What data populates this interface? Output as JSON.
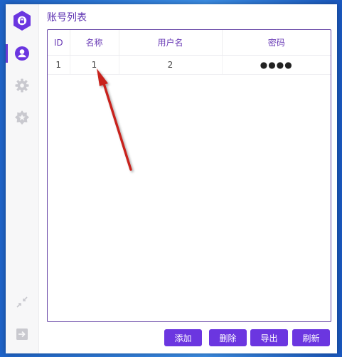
{
  "page": {
    "title": "账号列表"
  },
  "sidebar": {
    "items": [
      {
        "icon": "account-icon",
        "active": true
      },
      {
        "icon": "gear-icon",
        "active": false
      },
      {
        "icon": "star-badge-icon",
        "active": false
      }
    ],
    "bottom": [
      {
        "icon": "collapse-arrows-icon"
      },
      {
        "icon": "logout-icon"
      }
    ]
  },
  "table": {
    "columns": [
      "ID",
      "名称",
      "用户名",
      "密码"
    ],
    "rows": [
      {
        "id": "1",
        "name": "1",
        "username": "2",
        "password": "●●●●"
      }
    ]
  },
  "buttons": {
    "add": "添加",
    "delete": "删除",
    "export": "导出",
    "refresh": "刷新"
  },
  "colors": {
    "accent": "#6b36e0",
    "title": "#5b2fb0",
    "annotation_arrow": "#c8231f"
  }
}
